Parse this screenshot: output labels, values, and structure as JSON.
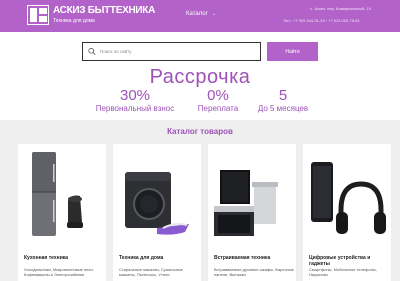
{
  "header": {
    "logo_title": "АСКИЗ БЫТТЕХНИКА",
    "logo_subtitle": "Техника для дома",
    "catalog_menu": "Каталог",
    "address": "с. Аскиз, пер. Коммунальный, 10",
    "phones": "Тел.: +7 929 344-91-25 / +7 913 053-79-81"
  },
  "search": {
    "placeholder": "Поиск по сайту",
    "button_label": "Найти"
  },
  "promo": {
    "title": "Рассрочка",
    "stats": [
      {
        "value": "30%",
        "label": "Первональный взнос"
      },
      {
        "value": "0%",
        "label": "Переплата"
      },
      {
        "value": "5",
        "label": "До 5 месяцев"
      }
    ]
  },
  "catalog": {
    "heading": "Каталог товаров",
    "categories": [
      {
        "title": "Кухонная техника",
        "desc": "Холодильники, Микроволновые печи, Кофемашины и Электрочайники"
      },
      {
        "title": "Техника для дома",
        "desc": "Стиральные машины, Сушильные машины, Пылесосы, Утюги"
      },
      {
        "title": "Встраиваемая техника",
        "desc": "Встраиваемые духовые шкафы, Варочные панели, Вытяжки"
      },
      {
        "title": "Цифровые устройства и гаджеты",
        "desc": "Смартфоны, Мобильные телефоны, Наушники"
      }
    ]
  },
  "colors": {
    "brand": "#b262c8",
    "accent_text": "#9e52b8",
    "catalog_bg": "#efefef"
  },
  "icons": {
    "search": "search-icon",
    "chevron": "chevron-down-icon"
  }
}
